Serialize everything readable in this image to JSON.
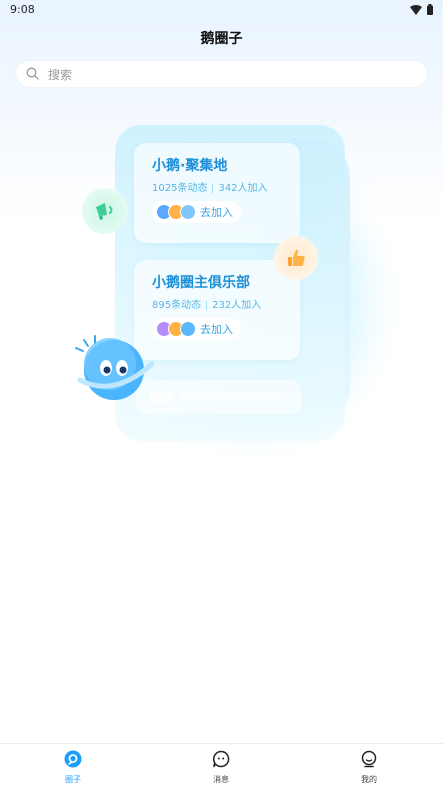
{
  "status_bar": {
    "time": "9:08"
  },
  "header": {
    "title": "鹅圈子"
  },
  "search": {
    "placeholder": "搜索"
  },
  "cards": [
    {
      "title": "小鹅·聚集地",
      "posts": "1025条动态",
      "members": "342人加入",
      "join_label": "去加入"
    },
    {
      "title": "小鹅圈主俱乐部",
      "posts": "895条动态",
      "members": "232人加入",
      "join_label": "去加入"
    }
  ],
  "tabs": [
    {
      "label": "圈子",
      "icon": "circle-icon",
      "active": true
    },
    {
      "label": "消息",
      "icon": "message-icon",
      "active": false
    },
    {
      "label": "我的",
      "icon": "profile-icon",
      "active": false
    }
  ],
  "colors": {
    "accent": "#19a0ff",
    "card_title": "#1e90d8",
    "bg_tint": "#e9f4ff"
  }
}
